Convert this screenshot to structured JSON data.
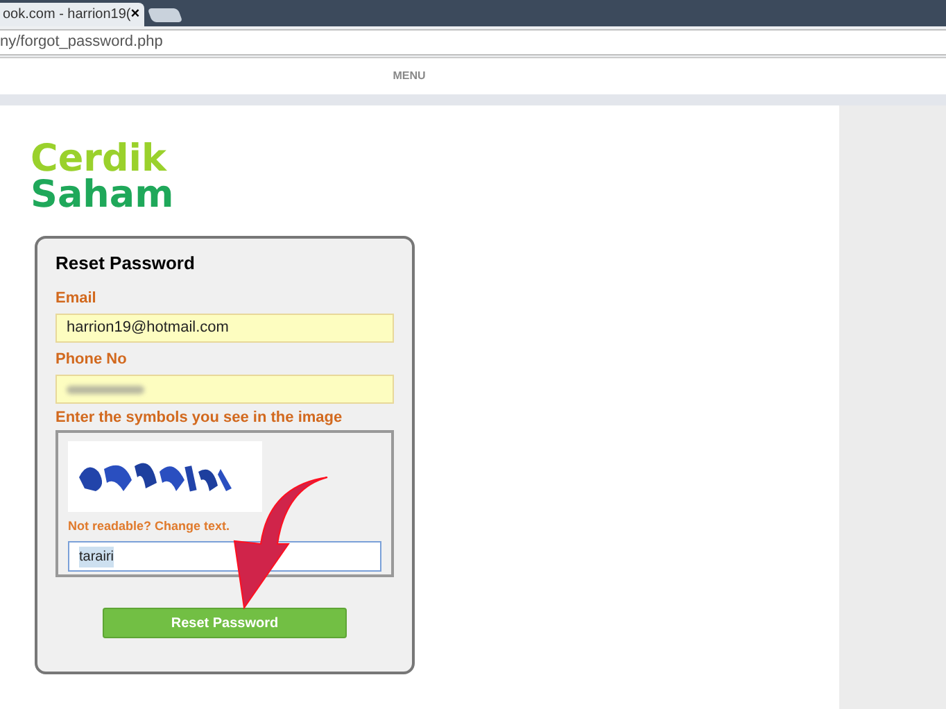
{
  "browser": {
    "tab_title": "ook.com - harrion19(",
    "tab_close": "×",
    "address": "ny/forgot_password.php"
  },
  "nav": {
    "menu": "MENU"
  },
  "logo": {
    "line_1": "Cerdik",
    "line_2": "Saham"
  },
  "form": {
    "title": "Reset Password",
    "fields": [
      {
        "label": "Email",
        "value": "harrion19@hotmail.com",
        "kind": "text"
      },
      {
        "label": "Phone No",
        "kind": "redacted"
      }
    ],
    "captcha": {
      "label": "Enter the symbols you see in the image",
      "change_link": "Not readable? Change text.",
      "value": "tarairi"
    },
    "submit": "Reset Password"
  }
}
